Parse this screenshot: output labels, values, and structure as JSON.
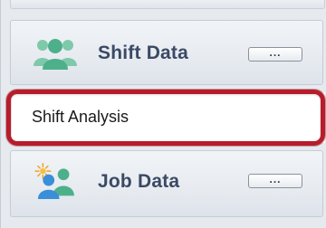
{
  "sections": [
    {
      "title": "Shift Data",
      "icon": "people-group-icon",
      "menu_label": "..."
    },
    {
      "title": "Job Data",
      "icon": "people-sun-icon",
      "menu_label": "..."
    }
  ],
  "shift_items": [
    {
      "label": "Shift Analysis"
    }
  ],
  "colors": {
    "title": "#3a4a66",
    "icon_green": "#4db08a",
    "icon_blue": "#3a8fd8",
    "icon_orange": "#f0a020",
    "highlight": "#b81c2c"
  }
}
